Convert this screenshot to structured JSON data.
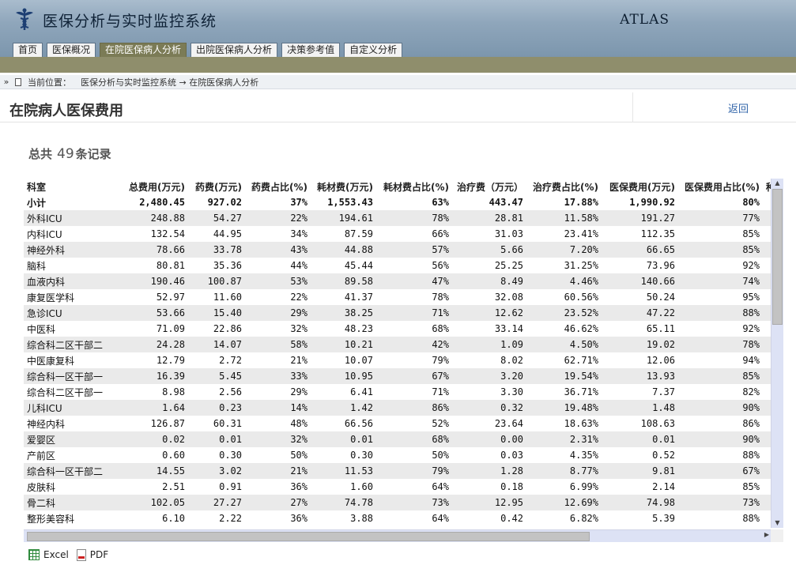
{
  "header": {
    "app_title": "医保分析与实时监控系统",
    "brand": "ATLAS",
    "logo_icon": "caduceus-icon"
  },
  "nav": {
    "tabs": [
      {
        "label": "首页"
      },
      {
        "label": "医保概况"
      },
      {
        "label": "在院医保病人分析",
        "active": true
      },
      {
        "label": "出院医保病人分析"
      },
      {
        "label": "决策参考值"
      },
      {
        "label": "自定义分析"
      }
    ]
  },
  "breadcrumb": {
    "label": "当前位置：",
    "path": "医保分析与实时监控系统 → 在院医保病人分析"
  },
  "page": {
    "title": "在院病人医保费用",
    "back_label": "返回",
    "count_prefix": "总共",
    "count_value": "49",
    "count_suffix": "条记录"
  },
  "table": {
    "columns": [
      "科室",
      "总费用(万元)",
      "药费(万元)",
      "药费占比(%)",
      "耗材费(万元)",
      "耗材费占比(%)",
      "治疗费（万元）",
      "治疗费占比(%)",
      "医保费用(万元)",
      "医保费用占比(%)",
      "种"
    ],
    "subtotal": [
      "小计",
      "2,480.45",
      "927.02",
      "37%",
      "1,553.43",
      "63%",
      "443.47",
      "17.88%",
      "1,990.92",
      "80%",
      ""
    ],
    "rows": [
      [
        "外科ICU",
        "248.88",
        "54.27",
        "22%",
        "194.61",
        "78%",
        "28.81",
        "11.58%",
        "191.27",
        "77%"
      ],
      [
        "内科ICU",
        "132.54",
        "44.95",
        "34%",
        "87.59",
        "66%",
        "31.03",
        "23.41%",
        "112.35",
        "85%"
      ],
      [
        "神经外科",
        "78.66",
        "33.78",
        "43%",
        "44.88",
        "57%",
        "5.66",
        "7.20%",
        "66.65",
        "85%"
      ],
      [
        "脑科",
        "80.81",
        "35.36",
        "44%",
        "45.44",
        "56%",
        "25.25",
        "31.25%",
        "73.96",
        "92%"
      ],
      [
        "血液内科",
        "190.46",
        "100.87",
        "53%",
        "89.58",
        "47%",
        "8.49",
        "4.46%",
        "140.66",
        "74%"
      ],
      [
        "康复医学科",
        "52.97",
        "11.60",
        "22%",
        "41.37",
        "78%",
        "32.08",
        "60.56%",
        "50.24",
        "95%"
      ],
      [
        "急诊ICU",
        "53.66",
        "15.40",
        "29%",
        "38.25",
        "71%",
        "12.62",
        "23.52%",
        "47.22",
        "88%"
      ],
      [
        "中医科",
        "71.09",
        "22.86",
        "32%",
        "48.23",
        "68%",
        "33.14",
        "46.62%",
        "65.11",
        "92%"
      ],
      [
        "综合科二区干部二",
        "24.28",
        "14.07",
        "58%",
        "10.21",
        "42%",
        "1.09",
        "4.50%",
        "19.02",
        "78%"
      ],
      [
        "中医康复科",
        "12.79",
        "2.72",
        "21%",
        "10.07",
        "79%",
        "8.02",
        "62.71%",
        "12.06",
        "94%"
      ],
      [
        "综合科一区干部一",
        "16.39",
        "5.45",
        "33%",
        "10.95",
        "67%",
        "3.20",
        "19.54%",
        "13.93",
        "85%"
      ],
      [
        "综合科二区干部一",
        "8.98",
        "2.56",
        "29%",
        "6.41",
        "71%",
        "3.30",
        "36.71%",
        "7.37",
        "82%"
      ],
      [
        "儿科ICU",
        "1.64",
        "0.23",
        "14%",
        "1.42",
        "86%",
        "0.32",
        "19.48%",
        "1.48",
        "90%"
      ],
      [
        "神经内科",
        "126.87",
        "60.31",
        "48%",
        "66.56",
        "52%",
        "23.64",
        "18.63%",
        "108.63",
        "86%"
      ],
      [
        "爱婴区",
        "0.02",
        "0.01",
        "32%",
        "0.01",
        "68%",
        "0.00",
        "2.31%",
        "0.01",
        "90%"
      ],
      [
        "产前区",
        "0.60",
        "0.30",
        "50%",
        "0.30",
        "50%",
        "0.03",
        "4.35%",
        "0.52",
        "88%"
      ],
      [
        "综合科一区干部二",
        "14.55",
        "3.02",
        "21%",
        "11.53",
        "79%",
        "1.28",
        "8.77%",
        "9.81",
        "67%"
      ],
      [
        "皮肤科",
        "2.51",
        "0.91",
        "36%",
        "1.60",
        "64%",
        "0.18",
        "6.99%",
        "2.14",
        "85%"
      ],
      [
        "骨二科",
        "102.05",
        "27.27",
        "27%",
        "74.78",
        "73%",
        "12.95",
        "12.69%",
        "74.98",
        "73%"
      ],
      [
        "整形美容科",
        "6.10",
        "2.22",
        "36%",
        "3.88",
        "64%",
        "0.42",
        "6.82%",
        "5.39",
        "88%"
      ]
    ]
  },
  "export": {
    "excel_label": "Excel",
    "pdf_label": "PDF"
  }
}
